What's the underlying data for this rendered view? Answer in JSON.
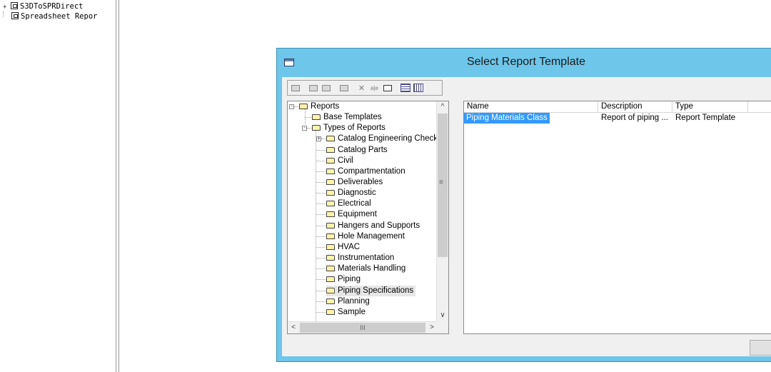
{
  "background_tree": {
    "items": [
      {
        "label": "S3DToSPRDirect",
        "expander": "+"
      },
      {
        "label": "Spreadsheet Repor",
        "expander": ""
      }
    ]
  },
  "dialog": {
    "title": "Select Report Template",
    "toolbar": {
      "buttons": [
        "up-folder-icon",
        "new-folder-icon",
        "new-item-icon",
        "properties-icon",
        "delete-icon",
        "rename-icon",
        "details-icon",
        "list-view-icon",
        "detail-view-icon"
      ]
    },
    "tree": {
      "root": "Reports",
      "expanders": {
        "reports": "-",
        "types": "-",
        "catalog_checks": "+"
      },
      "children": {
        "base_templates": "Base Templates",
        "types_of_reports": "Types of Reports"
      },
      "types": [
        "Catalog Engineering Checks",
        "Catalog Parts",
        "Civil",
        "Compartmentation",
        "Deliverables",
        "Diagnostic",
        "Electrical",
        "Equipment",
        "Hangers and Supports",
        "Hole Management",
        "HVAC",
        "Instrumentation",
        "Materials Handling",
        "Piping",
        "Piping Specifications",
        "Planning",
        "Sample"
      ],
      "selected": "Piping Specifications",
      "scroll_glyphs": {
        "up": "^",
        "down": "∨",
        "left": "<",
        "right": ">",
        "grip": "≡",
        "hgrip": "III"
      }
    },
    "list": {
      "columns": [
        "Name",
        "Description",
        "Type"
      ],
      "rows": [
        {
          "name": "Piping Materials Class",
          "description": "Report of piping ...",
          "type": "Report Template"
        }
      ]
    }
  }
}
